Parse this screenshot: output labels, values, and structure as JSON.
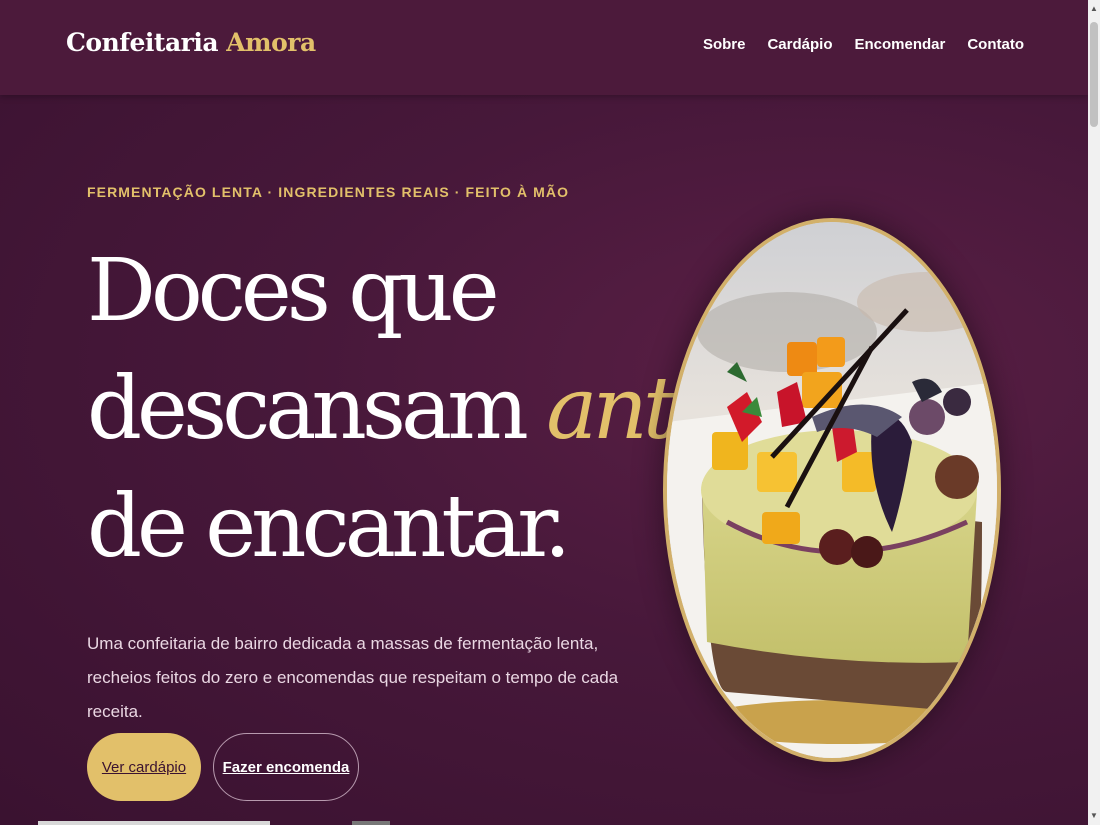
{
  "header": {
    "brand_main": "Confeitaria",
    "brand_accent": "Amora",
    "nav": [
      {
        "label": "Sobre"
      },
      {
        "label": "Cardápio"
      },
      {
        "label": "Encomendar"
      },
      {
        "label": "Contato"
      }
    ]
  },
  "hero": {
    "eyebrow": "FERMENTAÇÃO LENTA · INGREDIENTES REAIS · FEITO À MÃO",
    "headline_line1": "Doces que",
    "headline_line2_start": "descansam ",
    "headline_line2_accent": "antes",
    "headline_line3": "de encantar.",
    "lead": "Uma confeitaria de bairro dedicada a massas de fermentação lenta, recheios feitos do zero e encomendas que respeitam o tempo de cada receita.",
    "primary_button": "Ver cardápio",
    "secondary_button": "Fazer encomenda"
  },
  "colors": {
    "background": "#47183a",
    "nav_background": "#4c1a3b",
    "accent_gold": "#e2c06a",
    "text_white": "#ffffff"
  },
  "icons": {
    "scroll_up": "triangle-up",
    "scroll_down": "triangle-down"
  }
}
